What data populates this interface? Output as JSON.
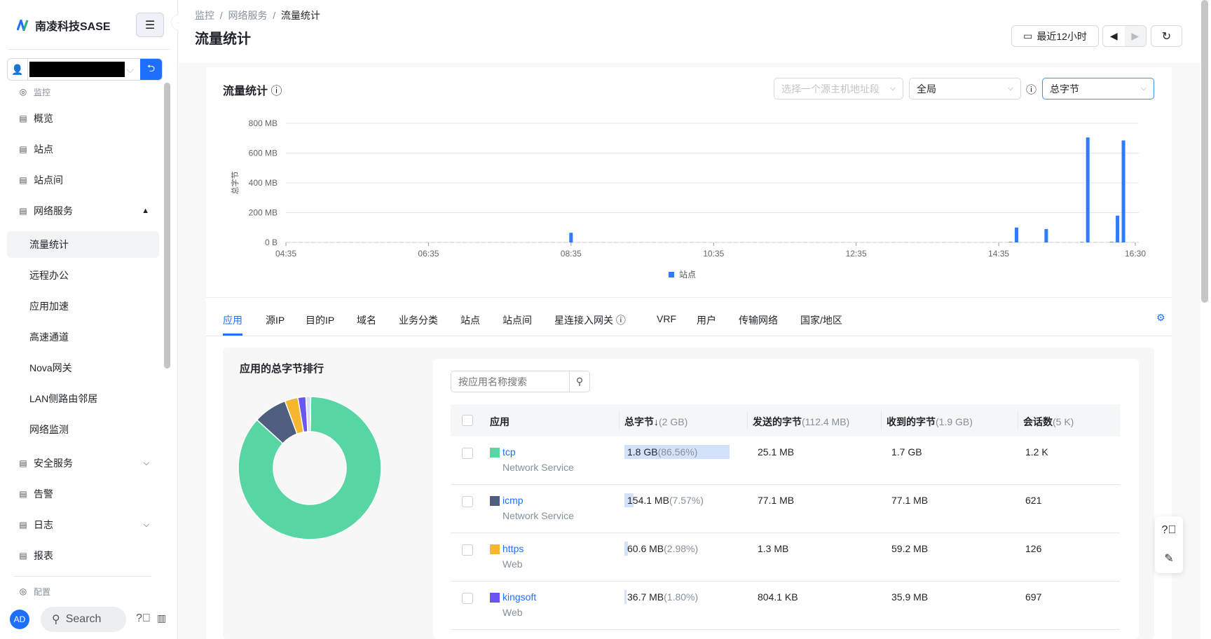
{
  "brand": {
    "name": "南凌科技SASE"
  },
  "sidebar": {
    "items": [
      {
        "label": "监控",
        "type": "group",
        "icon": "gauge-icon"
      },
      {
        "label": "概览",
        "icon": "overview-icon"
      },
      {
        "label": "站点",
        "icon": "building-icon"
      },
      {
        "label": "站点间",
        "icon": "sites-link-icon"
      },
      {
        "label": "网络服务",
        "icon": "network-service-icon",
        "expanded": true
      },
      {
        "label": "流量统计",
        "sub": true,
        "active": true
      },
      {
        "label": "远程办公",
        "sub": true
      },
      {
        "label": "应用加速",
        "sub": true
      },
      {
        "label": "高速通道",
        "sub": true
      },
      {
        "label": "Nova网关",
        "sub": true
      },
      {
        "label": "LAN侧路由邻居",
        "sub": true
      },
      {
        "label": "网络监测",
        "sub": true
      },
      {
        "label": "安全服务",
        "icon": "shield-icon",
        "expanded": false
      },
      {
        "label": "告警",
        "icon": "alert-icon"
      },
      {
        "label": "日志",
        "icon": "log-icon",
        "expanded": false
      },
      {
        "label": "报表",
        "icon": "report-icon"
      },
      {
        "label": "配置",
        "type": "group",
        "icon": "config-icon"
      }
    ],
    "avatar": "AD",
    "search": "Search"
  },
  "header": {
    "breadcrumb": [
      "监控",
      "网络服务",
      "流量统计"
    ],
    "title": "流量统计",
    "time_range": "最近12小时"
  },
  "chart_card": {
    "title": "流量统计",
    "source_placeholder": "选择一个源主机地址段",
    "scope": "全局",
    "metric": "总字节"
  },
  "chart_data": {
    "type": "bar",
    "ylabel": "总字节",
    "yticks": [
      "0 B",
      "200 MB",
      "400 MB",
      "600 MB",
      "800 MB"
    ],
    "ylim": [
      0,
      800
    ],
    "yunit": "MB",
    "xticks": [
      "04:35",
      "06:35",
      "08:35",
      "10:35",
      "12:35",
      "14:35",
      "16:30"
    ],
    "xlim": [
      "04:35",
      "16:30"
    ],
    "legend": {
      "position": "bottom"
    },
    "grid": true,
    "color": "#2f7cf6",
    "series": [
      {
        "name": "站点",
        "points": [
          [
            "08:35",
            65
          ],
          [
            "14:45",
            4
          ],
          [
            "14:50",
            100
          ],
          [
            "15:15",
            90
          ],
          [
            "15:45",
            3
          ],
          [
            "15:50",
            705
          ],
          [
            "16:10",
            4
          ],
          [
            "16:15",
            180
          ],
          [
            "16:20",
            685
          ]
        ]
      }
    ]
  },
  "tabs": [
    "应用",
    "源IP",
    "目的IP",
    "域名",
    "业务分类",
    "站点",
    "站点间",
    "星连接入网关",
    "VRF",
    "用户",
    "传输网络",
    "国家/地区"
  ],
  "ranking": {
    "title": "应用的总字节排行",
    "search_placeholder": "按应用名称搜索"
  },
  "table": {
    "headers": [
      {
        "label": "应用"
      },
      {
        "label": "总字节↓",
        "extra": "(2 GB)"
      },
      {
        "label": "发送的字节",
        "extra": "(112.4 MB)"
      },
      {
        "label": "收到的字节",
        "extra": "(1.9 GB)"
      },
      {
        "label": "会话数",
        "extra": "(5 K)"
      }
    ],
    "rows": [
      {
        "app": "tcp",
        "category": "Network Service",
        "color": "#57d5a3",
        "total": "1.8 GB",
        "pct": "(86.56%)",
        "pctv": 86.56,
        "sent": "25.1 MB",
        "recv": "1.7 GB",
        "sessions": "1.2 K"
      },
      {
        "app": "icmp",
        "category": "Network Service",
        "color": "#4f5d7e",
        "total": "154.1 MB",
        "pct": "(7.57%)",
        "pctv": 7.57,
        "sent": "77.1 MB",
        "recv": "77.1 MB",
        "sessions": "621"
      },
      {
        "app": "https",
        "category": "Web",
        "color": "#f5b630",
        "total": "60.6 MB",
        "pct": "(2.98%)",
        "pctv": 2.98,
        "sent": "1.3 MB",
        "recv": "59.2 MB",
        "sessions": "126"
      },
      {
        "app": "kingsoft",
        "category": "Web",
        "color": "#6a55f2",
        "total": "36.7 MB",
        "pct": "(1.80%)",
        "pctv": 1.8,
        "sent": "804.1 KB",
        "recv": "35.9 MB",
        "sessions": "697"
      }
    ]
  },
  "colors": {
    "accent": "#1f6fff",
    "bar_fill": "#d3e1fb"
  }
}
